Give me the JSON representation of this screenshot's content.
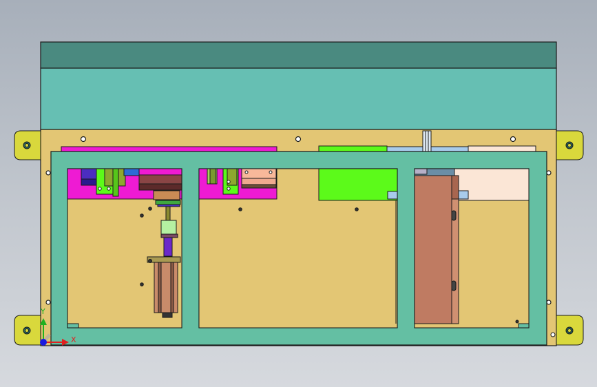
{
  "viewport": {
    "background_top": "#a7afba",
    "background_bottom": "#d6d9de"
  },
  "triad": {
    "x_label": "X",
    "y_label": "Y",
    "x_color": "#e02020",
    "y_color": "#20b020",
    "z_color": "#1a1ae0"
  },
  "colors": {
    "cover_dark": "#4a8a80",
    "cover_light": "#66bfb3",
    "plate": "#e3c674",
    "frame": "#64bfa3",
    "mounting_ear": "#d9d83c",
    "magenta": "#ee1bd3",
    "green_block": "#5cfa1a",
    "light_blue": "#a8cbeb",
    "peach": "#fbe6d6",
    "brown": "#bf7b62"
  }
}
